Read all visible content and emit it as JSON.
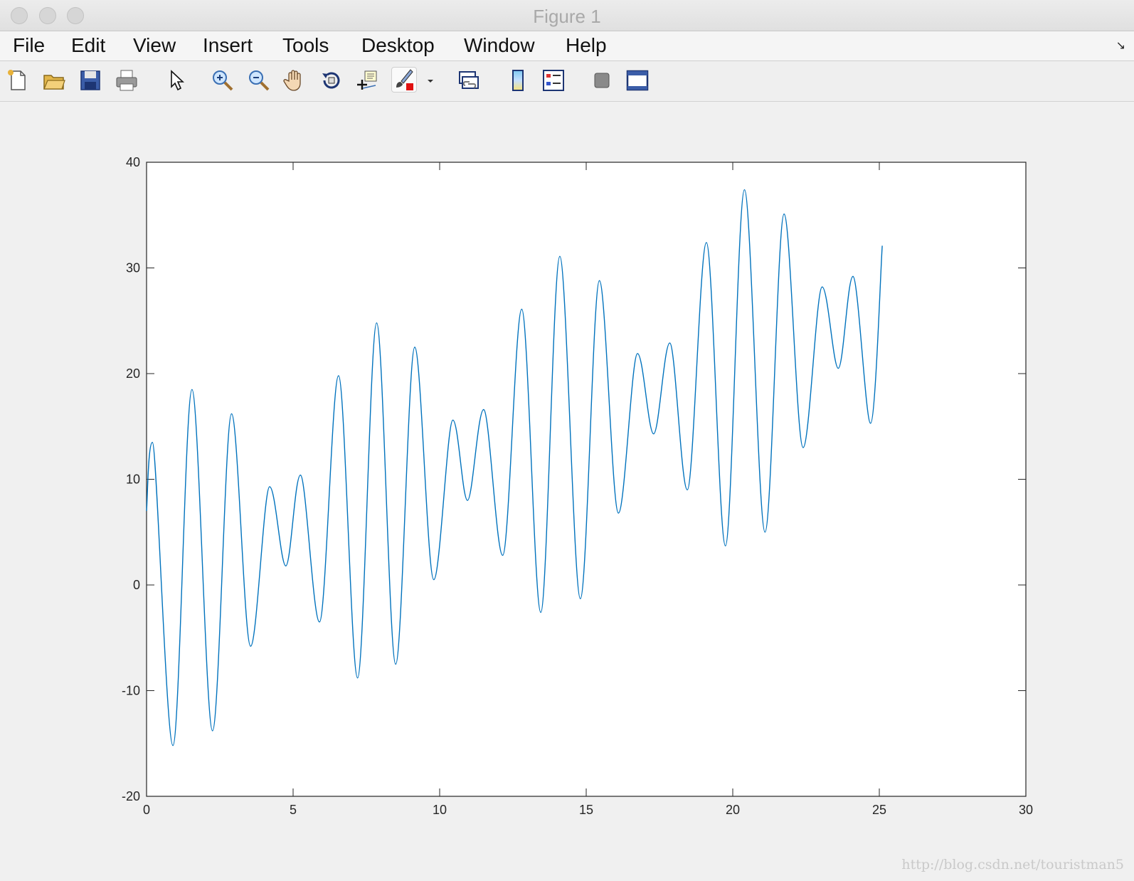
{
  "window": {
    "title": "Figure 1"
  },
  "menu": [
    "File",
    "Edit",
    "View",
    "Insert",
    "Tools",
    "Desktop",
    "Window",
    "Help"
  ],
  "toolbar_icons": [
    "new-figure-icon",
    "open-file-icon",
    "save-icon",
    "print-icon",
    "pointer-icon",
    "zoom-in-icon",
    "zoom-out-icon",
    "pan-hand-icon",
    "rotate-3d-icon",
    "data-cursor-icon",
    "brush-icon",
    "dropdown-arrow-icon",
    "link-plot-icon",
    "colorbar-icon",
    "legend-icon",
    "hide-plot-tools-icon",
    "show-plot-tools-icon"
  ],
  "watermark": "http://blog.csdn.net/touristman5",
  "chart_data": {
    "type": "line",
    "title": "",
    "xlabel": "",
    "ylabel": "",
    "xlim": [
      0,
      30
    ],
    "ylim": [
      -20,
      40
    ],
    "xticks": [
      0,
      5,
      10,
      15,
      20,
      25,
      30
    ],
    "yticks": [
      -20,
      -10,
      0,
      10,
      20,
      30,
      40
    ],
    "grid": false,
    "line_color": "#0072bd",
    "series": [
      {
        "x": [
          0,
          0.2,
          0.9,
          1.55,
          2.25,
          2.9,
          3.55,
          4.2,
          4.75,
          5.25,
          5.9,
          6.55,
          7.2,
          7.85,
          8.5,
          9.15,
          9.8,
          10.45,
          10.95,
          11.5,
          12.15,
          12.8,
          13.45,
          14.1,
          14.8,
          15.45,
          16.1,
          16.75,
          17.3,
          17.85,
          18.45,
          19.1,
          19.75,
          20.4,
          21.1,
          21.75,
          22.4,
          23.05,
          23.6,
          24.1,
          24.7,
          25.1
        ],
        "y": [
          7,
          13.5,
          -15.2,
          18.5,
          -13.8,
          16.2,
          -5.8,
          9.3,
          1.8,
          10.4,
          -3.5,
          19.8,
          -8.8,
          24.8,
          -7.5,
          22.5,
          0.5,
          15.6,
          8.0,
          16.6,
          2.8,
          26.1,
          -2.6,
          31.1,
          -1.3,
          28.8,
          6.8,
          21.9,
          14.3,
          22.9,
          9.0,
          32.4,
          3.7,
          37.4,
          5.0,
          35.1,
          13.0,
          28.2,
          20.5,
          29.2,
          15.3,
          32.1
        ]
      }
    ]
  }
}
